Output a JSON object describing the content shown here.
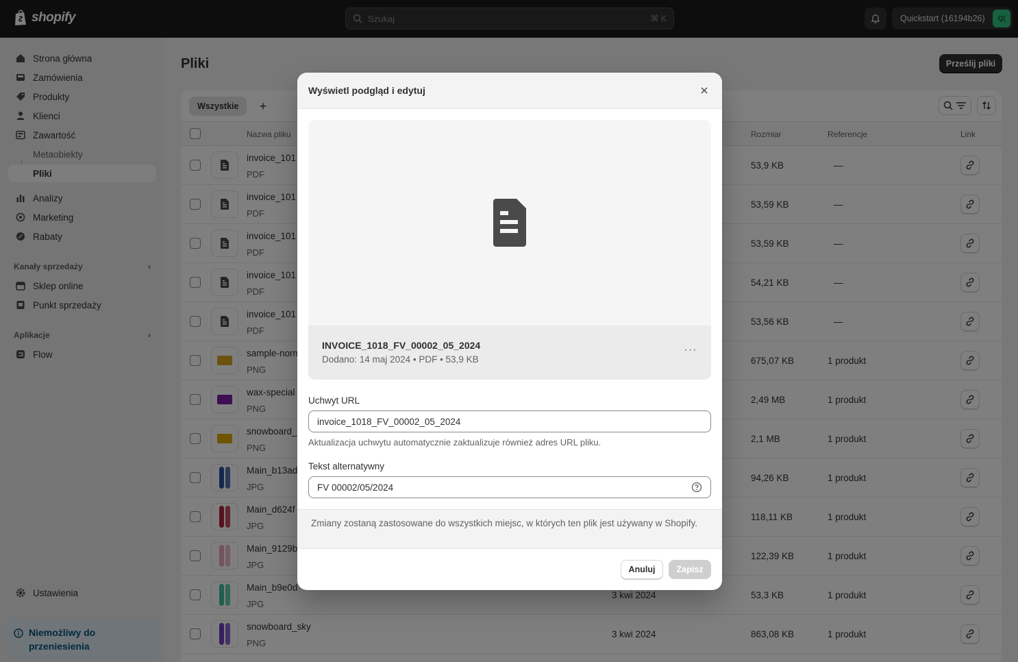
{
  "topbar": {
    "brand": "shopify",
    "search_placeholder": "Szukaj",
    "search_shortcut": "⌘ K",
    "store_name": "Quickstart (16194b26)",
    "store_initials": "Q(",
    "icons": [
      "shopify-bag-icon",
      "search-icon",
      "bell-icon"
    ]
  },
  "sidebar": {
    "items": [
      {
        "label": "Strona główna",
        "icon": "home-icon"
      },
      {
        "label": "Zamówienia",
        "icon": "inbox-icon"
      },
      {
        "label": "Produkty",
        "icon": "tag-icon"
      },
      {
        "label": "Klienci",
        "icon": "person-icon"
      },
      {
        "label": "Zawartość",
        "icon": "content-icon"
      },
      {
        "label": "Metaobiekty",
        "icon": ""
      },
      {
        "label": "Pliki",
        "icon": ""
      },
      {
        "label": "Analizy",
        "icon": "chart-icon"
      },
      {
        "label": "Marketing",
        "icon": "target-icon"
      },
      {
        "label": "Rabaty",
        "icon": "discount-icon"
      }
    ],
    "sales_section": "Kanały sprzedaży",
    "sales_items": [
      {
        "label": "Sklep online",
        "icon": "store-icon"
      },
      {
        "label": "Punkt sprzedaży",
        "icon": "pos-icon"
      }
    ],
    "apps_section": "Aplikacje",
    "apps_items": [
      {
        "label": "Flow",
        "icon": "flow-icon"
      }
    ],
    "settings": "Ustawienia",
    "notice": "Niemożliwy do przeniesienia"
  },
  "main": {
    "title": "Pliki",
    "upload_label": "Prześlij pliki",
    "tab_all": "Wszystkie",
    "tab_add": "+",
    "columns": {
      "name": "Nazwa pliku",
      "size": "Rozmiar",
      "refs": "Referencje",
      "link": "Link"
    },
    "rows": [
      {
        "name": "invoice_101",
        "type": "PDF",
        "date": "",
        "size": "53,9 KB",
        "refs": "—",
        "thumb": "doc"
      },
      {
        "name": "invoice_101",
        "type": "PDF",
        "date": "",
        "size": "53,59 KB",
        "refs": "—",
        "thumb": "doc"
      },
      {
        "name": "invoice_101",
        "type": "PDF",
        "date": "",
        "size": "53,59 KB",
        "refs": "—",
        "thumb": "doc"
      },
      {
        "name": "invoice_101",
        "type": "PDF",
        "date": "",
        "size": "54,21 KB",
        "refs": "—",
        "thumb": "doc"
      },
      {
        "name": "invoice_101",
        "type": "PDF",
        "date": "",
        "size": "53,56 KB",
        "refs": "—",
        "thumb": "doc"
      },
      {
        "name": "sample-norm",
        "type": "PNG",
        "date": "",
        "size": "675,07 KB",
        "refs": "1 produkt",
        "thumb": "#d9a521"
      },
      {
        "name": "wax-special",
        "type": "PNG",
        "date": "",
        "size": "2,49 MB",
        "refs": "1 produkt",
        "thumb": "#7a1fa2"
      },
      {
        "name": "snowboard_",
        "type": "PNG",
        "date": "",
        "size": "2,1 MB",
        "refs": "1 produkt",
        "thumb": "#e0a800"
      },
      {
        "name": "Main_b13ad",
        "type": "JPG",
        "date": "",
        "size": "94,26 KB",
        "refs": "1 produkt",
        "thumb": "#2b4f9e"
      },
      {
        "name": "Main_d624f",
        "type": "JPG",
        "date": "",
        "size": "118,11 KB",
        "refs": "1 produkt",
        "thumb": "#b0233c"
      },
      {
        "name": "Main_9129b",
        "type": "JPG",
        "date": "",
        "size": "122,39 KB",
        "refs": "1 produkt",
        "thumb": "#e7a7b8"
      },
      {
        "name": "Main_b9e0d",
        "type": "JPG",
        "date": "3 kwi 2024",
        "size": "53,3 KB",
        "refs": "1 produkt",
        "thumb": "#3fbf9f"
      },
      {
        "name": "snowboard_sky",
        "type": "PNG",
        "date": "3 kwi 2024",
        "size": "863,08 KB",
        "refs": "1 produkt",
        "thumb": "#6d3fbf"
      }
    ]
  },
  "modal": {
    "title": "Wyświetl podgląd i edytuj",
    "file_title": "INVOICE_1018_FV_00002_05_2024",
    "file_meta": "Dodano: 14 maj 2024 • PDF • 53,9 KB",
    "more": "···",
    "url_label": "Uchwyt URL",
    "url_value": "invoice_1018_FV_00002_05_2024",
    "url_help": "Aktualizacja uchwytu automatycznie zaktualizuje również adres URL pliku.",
    "alt_label": "Tekst alternatywny",
    "alt_value": "FV 00002/05/2024",
    "note": "Zmiany zostaną zastosowane do wszystkich miejsc, w których ten plik jest używany w Shopify.",
    "cancel": "Anuluj",
    "save": "Zapisz"
  }
}
